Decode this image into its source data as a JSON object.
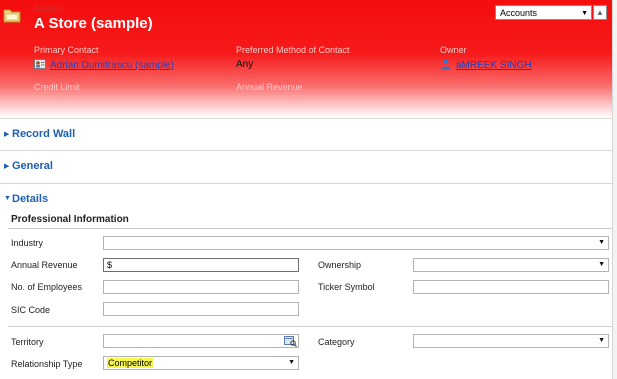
{
  "header": {
    "entity_label": "Account",
    "title": "A Store (sample)",
    "primary_contact_label": "Primary Contact",
    "primary_contact_value": "Adrian Dumitrascu (sample)",
    "preferred_method_label": "Preferred Method of Contact",
    "preferred_method_value": "Any",
    "owner_label": "Owner",
    "owner_value": "aMREEK SINGH",
    "credit_limit_label": "Credit Limit",
    "annual_revenue_label": "Annual Revenue",
    "nav_select_value": "Accounts"
  },
  "sections": {
    "record_wall": "Record Wall",
    "general": "General",
    "details": "Details"
  },
  "details": {
    "subheading": "Professional Information",
    "industry_label": "Industry",
    "annual_revenue_label": "Annual Revenue",
    "annual_revenue_value": "$",
    "ownership_label": "Ownership",
    "employees_label": "No. of Employees",
    "ticker_label": "Ticker Symbol",
    "sic_label": "SIC Code",
    "territory_label": "Territory",
    "category_label": "Category",
    "relationship_label": "Relationship Type",
    "relationship_value": "Competitor"
  },
  "colors": {
    "header_red": "#f40d0d",
    "section_blue": "#1d5fb3",
    "link_blue": "#1f3ec0",
    "highlight_yellow": "#f7f74b"
  }
}
